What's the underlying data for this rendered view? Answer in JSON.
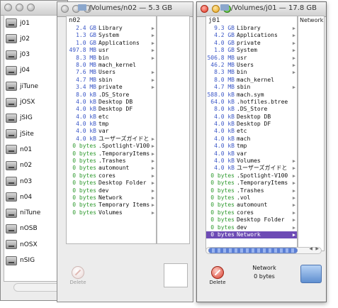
{
  "volumes": [
    "j01",
    "j02",
    "j03",
    "j04",
    "jiTune",
    "jOSX",
    "jSIG",
    "jSite",
    "n01",
    "n02",
    "n03",
    "n04",
    "niTune",
    "nOSB",
    "nOSX",
    "nSIG"
  ],
  "window_mid": {
    "title": "/Volumes/n02 — 5.3 GB",
    "column_header": "n02",
    "rows": [
      {
        "size": "2.4 GB",
        "name": "Library",
        "arrow": true
      },
      {
        "size": "1.3 GB",
        "name": "System",
        "arrow": true
      },
      {
        "size": "1.0 GB",
        "name": "Applications",
        "arrow": true
      },
      {
        "size": "497.8 MB",
        "name": "usr",
        "arrow": true
      },
      {
        "size": "8.3 MB",
        "name": "bin",
        "arrow": true
      },
      {
        "size": "8.0 MB",
        "name": "mach_kernel",
        "arrow": false
      },
      {
        "size": "7.6 MB",
        "name": "Users",
        "arrow": true
      },
      {
        "size": "4.7 MB",
        "name": "sbin",
        "arrow": true
      },
      {
        "size": "3.4 MB",
        "name": "private",
        "arrow": true
      },
      {
        "size": "8.0 kB",
        "name": ".DS_Store",
        "arrow": false
      },
      {
        "size": "4.0 kB",
        "name": "Desktop DB",
        "arrow": false
      },
      {
        "size": "4.0 kB",
        "name": "Desktop DF",
        "arrow": false
      },
      {
        "size": "4.0 kB",
        "name": "etc",
        "arrow": false
      },
      {
        "size": "4.0 kB",
        "name": "tmp",
        "arrow": false
      },
      {
        "size": "4.0 kB",
        "name": "var",
        "arrow": false
      },
      {
        "size": "4.0 kB",
        "name": "ユーザーズガイドと",
        "arrow": true
      },
      {
        "size": "0 bytes",
        "name": ".Spotlight-V100",
        "arrow": true
      },
      {
        "size": "0 bytes",
        "name": ".TemporaryItems",
        "arrow": true
      },
      {
        "size": "0 bytes",
        "name": ".Trashes",
        "arrow": true
      },
      {
        "size": "0 bytes",
        "name": "automount",
        "arrow": true
      },
      {
        "size": "0 bytes",
        "name": "cores",
        "arrow": true
      },
      {
        "size": "0 bytes",
        "name": "Desktop Folder",
        "arrow": true
      },
      {
        "size": "0 bytes",
        "name": "dev",
        "arrow": true
      },
      {
        "size": "0 bytes",
        "name": "Network",
        "arrow": true
      },
      {
        "size": "0 bytes",
        "name": "Temporary Items",
        "arrow": true
      },
      {
        "size": "0 bytes",
        "name": "Volumes",
        "arrow": true
      }
    ],
    "delete_label": "Delete"
  },
  "window_front": {
    "title": "/Volumes/j01 — 17.8 GB",
    "column_header": "j01",
    "second_column_header": "Network",
    "rows": [
      {
        "size": "9.3 GB",
        "name": "Library",
        "arrow": true
      },
      {
        "size": "4.2 GB",
        "name": "Applications",
        "arrow": true
      },
      {
        "size": "4.0 GB",
        "name": "private",
        "arrow": true
      },
      {
        "size": "1.8 GB",
        "name": "System",
        "arrow": true
      },
      {
        "size": "506.8 MB",
        "name": "usr",
        "arrow": true
      },
      {
        "size": "46.2 MB",
        "name": "Users",
        "arrow": true
      },
      {
        "size": "8.3 MB",
        "name": "bin",
        "arrow": true
      },
      {
        "size": "8.0 MB",
        "name": "mach_kernel",
        "arrow": false
      },
      {
        "size": "4.7 MB",
        "name": "sbin",
        "arrow": true
      },
      {
        "size": "588.0 kB",
        "name": "mach.sym",
        "arrow": false
      },
      {
        "size": "64.0 kB",
        "name": ".hotfiles.btree",
        "arrow": false
      },
      {
        "size": "8.0 kB",
        "name": ".DS_Store",
        "arrow": false
      },
      {
        "size": "4.0 kB",
        "name": "Desktop DB",
        "arrow": false
      },
      {
        "size": "4.0 kB",
        "name": "Desktop DF",
        "arrow": false
      },
      {
        "size": "4.0 kB",
        "name": "etc",
        "arrow": false
      },
      {
        "size": "4.0 kB",
        "name": "mach",
        "arrow": false
      },
      {
        "size": "4.0 kB",
        "name": "tmp",
        "arrow": false
      },
      {
        "size": "4.0 kB",
        "name": "var",
        "arrow": false
      },
      {
        "size": "4.0 kB",
        "name": "Volumes",
        "arrow": true
      },
      {
        "size": "4.0 kB",
        "name": "ユーザーズガイドと",
        "arrow": true
      },
      {
        "size": "0 bytes",
        "name": ".Spotlight-V100",
        "arrow": true
      },
      {
        "size": "0 bytes",
        "name": ".TemporaryItems",
        "arrow": true
      },
      {
        "size": "0 bytes",
        "name": ".Trashes",
        "arrow": true
      },
      {
        "size": "0 bytes",
        "name": ".vol",
        "arrow": true
      },
      {
        "size": "0 bytes",
        "name": "automount",
        "arrow": true
      },
      {
        "size": "0 bytes",
        "name": "cores",
        "arrow": true
      },
      {
        "size": "0 bytes",
        "name": "Desktop Folder",
        "arrow": true
      },
      {
        "size": "0 bytes",
        "name": "dev",
        "arrow": true
      },
      {
        "size": "0 bytes",
        "name": "Network",
        "arrow": true
      }
    ],
    "selected_index": 28,
    "selected_name": "Network",
    "selected_size": "0 bytes",
    "delete_label": "Delete"
  }
}
